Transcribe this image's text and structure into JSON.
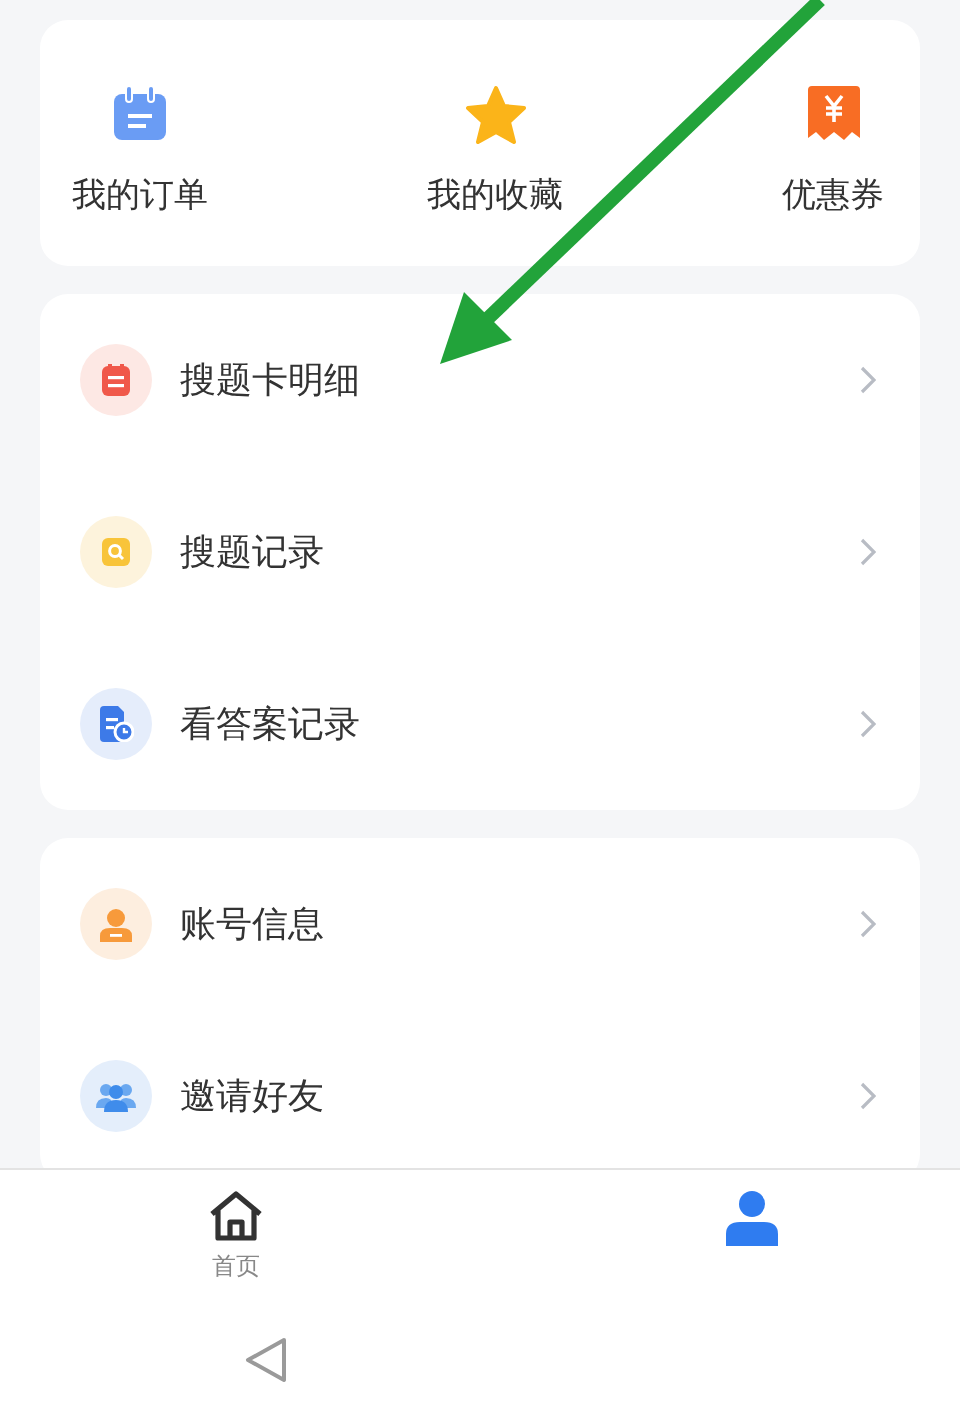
{
  "shortcuts": [
    {
      "kind": "calendar",
      "label": "我的订单"
    },
    {
      "kind": "star",
      "label": "我的收藏"
    },
    {
      "kind": "coupon",
      "label": "优惠券"
    }
  ],
  "menu_groups": [
    {
      "items": [
        {
          "kind": "card",
          "label": "搜题卡明细"
        },
        {
          "kind": "search",
          "label": "搜题记录"
        },
        {
          "kind": "document",
          "label": "看答案记录"
        }
      ]
    },
    {
      "items": [
        {
          "kind": "account",
          "label": "账号信息"
        },
        {
          "kind": "friends",
          "label": "邀请好友"
        }
      ]
    }
  ],
  "tab_bar": {
    "tabs": [
      {
        "kind": "home",
        "label": "首页",
        "selected": false
      },
      {
        "kind": "person",
        "selected": true
      }
    ]
  }
}
